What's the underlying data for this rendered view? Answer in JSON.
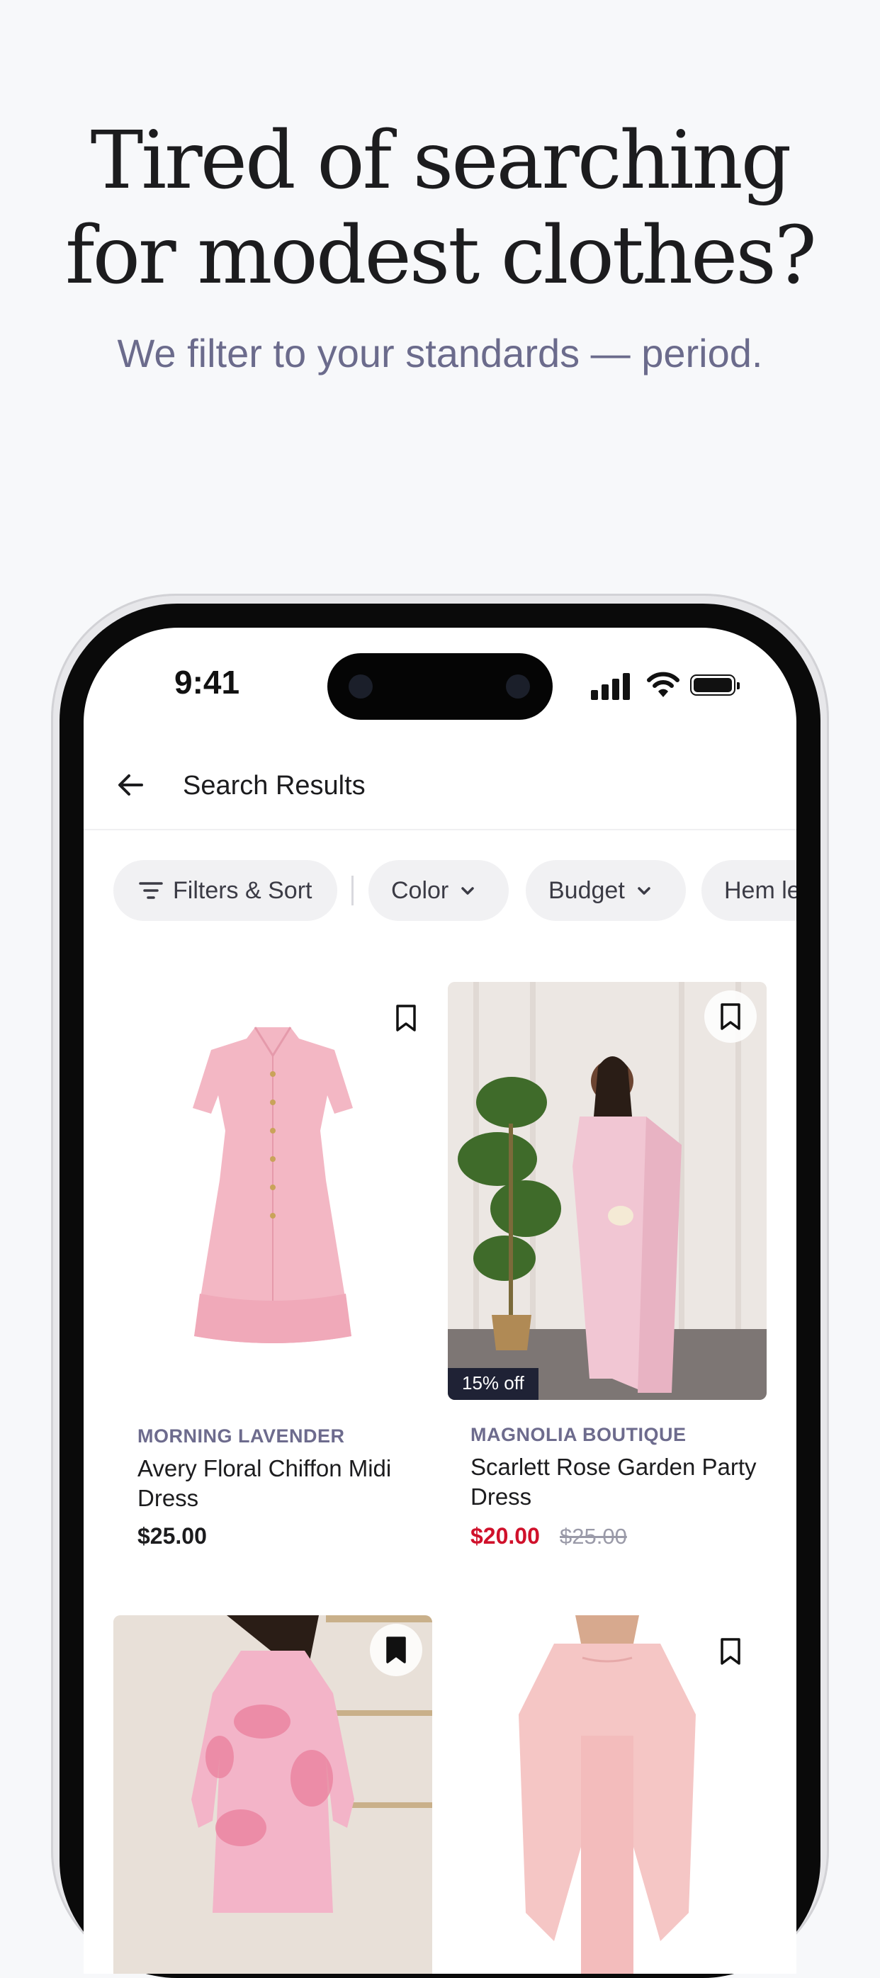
{
  "hero": {
    "headline_line1": "Tired of searching",
    "headline_line2": "for modest clothes?",
    "subhead": "We filter to your standards — period."
  },
  "status_bar": {
    "time": "9:41",
    "icons": [
      "signal-icon",
      "wifi-icon",
      "battery-icon"
    ]
  },
  "nav": {
    "title": "Search Results",
    "back_icon": "arrow-left-icon"
  },
  "filters": {
    "filters_sort": "Filters & Sort",
    "color": "Color",
    "budget": "Budget",
    "hem": "Hem le"
  },
  "products": [
    {
      "brand": "MORNING LAVENDER",
      "name": "Avery Floral Chiffon Midi Dress",
      "price": "$25.00",
      "bookmarked": false
    },
    {
      "brand": "MAGNOLIA BOUTIQUE",
      "name": "Scarlett Rose Garden Party Dress",
      "price": "$20.00",
      "original_price": "$25.00",
      "discount": "15% off",
      "bookmarked": false
    },
    {
      "brand": "",
      "name": "",
      "bookmarked": true
    },
    {
      "brand": "",
      "name": "",
      "bookmarked": false
    }
  ],
  "colors": {
    "accent_sale": "#d0112b",
    "brand_text": "#6d6b8d",
    "chip_bg": "#f1f1f3",
    "page_bg": "#f7f8fa"
  }
}
